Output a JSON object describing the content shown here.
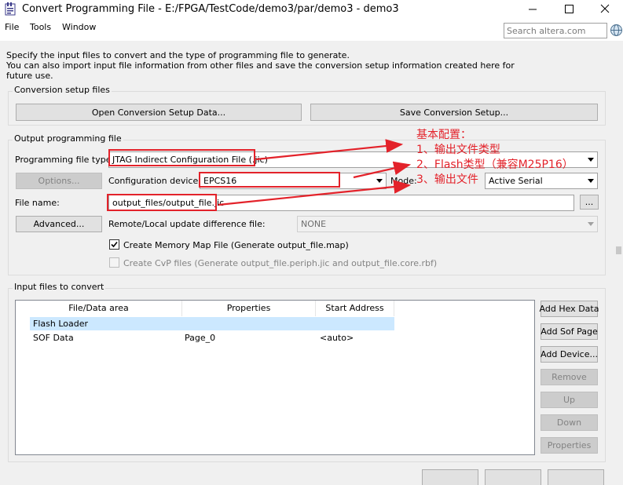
{
  "window": {
    "title": "Convert Programming File - E:/FPGA/TestCode/demo3/par/demo3 - demo3",
    "minimize_label": "—",
    "maximize_label": "☐",
    "close_label": "✕"
  },
  "menu": {
    "items": [
      "File",
      "Tools",
      "Window"
    ]
  },
  "search": {
    "placeholder": "Search altera.com"
  },
  "description": {
    "line1": "Specify the input files to convert and the type of programming file to generate.",
    "line2": "You can also import input file information from other files and save the conversion setup information created here for",
    "line3": "future use."
  },
  "conversion_setup": {
    "title": "Conversion setup files",
    "open_label": "Open Conversion Setup Data...",
    "save_label": "Save Conversion Setup..."
  },
  "output": {
    "title": "Output programming file",
    "file_type_label": "Programming file type:",
    "file_type_value": "JTAG Indirect Configuration File (.jic)",
    "options_label": "Options...",
    "config_device_label": "Configuration device:",
    "config_device_value": "EPCS16",
    "mode_label": "Mode:",
    "mode_value": "Active Serial",
    "file_name_label": "File name:",
    "file_name_value": "output_files/output_file.jic",
    "browse_label": "...",
    "advanced_label": "Advanced...",
    "remote_label": "Remote/Local update difference file:",
    "remote_value": "NONE",
    "memory_map_label": "Create Memory Map File (Generate output_file.map)",
    "memory_map_checked": true,
    "cvp_label": "Create CvP files (Generate output_file.periph.jic and output_file.core.rbf)",
    "cvp_checked": false
  },
  "input_files": {
    "title": "Input files to convert",
    "columns": [
      "File/Data area",
      "Properties",
      "Start Address"
    ],
    "rows": [
      {
        "area": "Flash Loader",
        "properties": "",
        "start": ""
      },
      {
        "area": "SOF Data",
        "properties": "Page_0",
        "start": "<auto>"
      }
    ],
    "buttons": {
      "add_hex": "Add Hex Data",
      "add_sof": "Add Sof Page",
      "add_device": "Add Device...",
      "remove": "Remove",
      "up": "Up",
      "down": "Down",
      "properties": "Properties"
    }
  },
  "annotations": {
    "title": "基本配置：",
    "item1": "1、输出文件类型",
    "item2": "2、Flash类型（兼容M25P16）",
    "item3": "3、输出文件"
  },
  "colors": {
    "annotation_red": "#e3222a",
    "selected_row": "#cce8ff"
  }
}
